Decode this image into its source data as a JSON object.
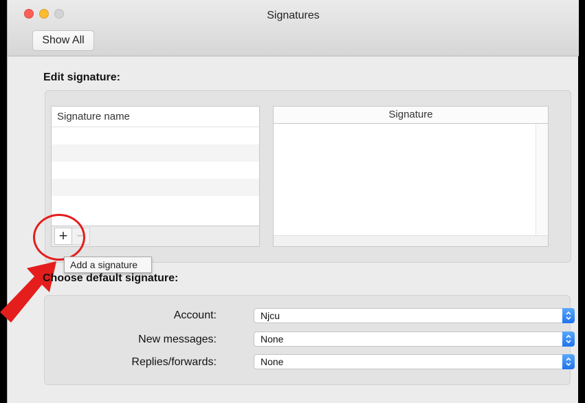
{
  "window": {
    "title": "Signatures",
    "show_all_label": "Show All"
  },
  "edit": {
    "section_title": "Edit signature:",
    "name_column_header": "Signature name",
    "signature_column_header": "Signature",
    "add_button_glyph": "+",
    "remove_button_glyph": "−",
    "tooltip": "Add a signature"
  },
  "defaults": {
    "section_title": "Choose default signature:",
    "account_label": "Account:",
    "account_value": "Njcu",
    "new_messages_label": "New messages:",
    "new_messages_value": "None",
    "replies_label": "Replies/forwards:",
    "replies_value": "None"
  },
  "annotation": {
    "highlight_color": "#e41d1d",
    "arrow_color": "#e41d1d"
  },
  "colors": {
    "stepper_blue": "#1e74ef",
    "close": "#fc5f57",
    "minimize": "#fdbc2e"
  }
}
